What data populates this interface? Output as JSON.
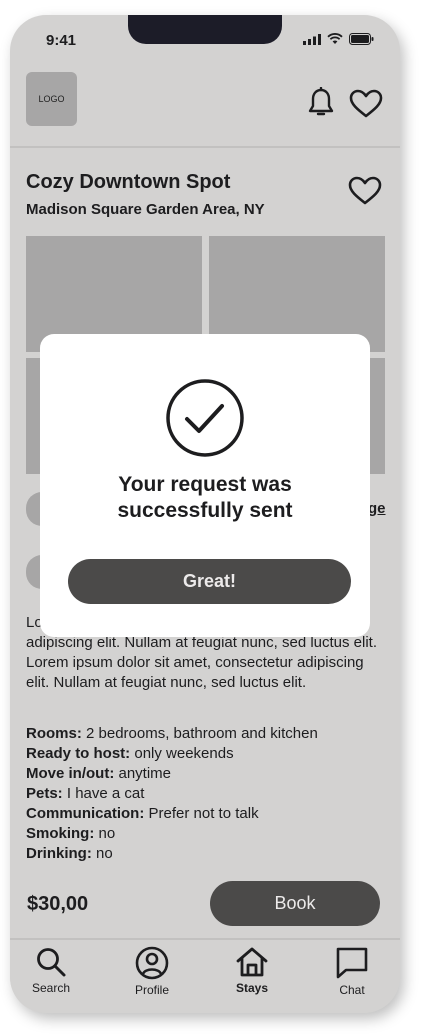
{
  "status": {
    "time": "9:41"
  },
  "header": {
    "logo_text": "LOGO"
  },
  "listing": {
    "title": "Cozy Downtown Spot",
    "location": "Madison Square Garden Area, NY",
    "description_partial_start": "Lo",
    "description_rest": "adipiscing elit. Nullam at feugiat nunc, sed luctus elit. Lorem ipsum dolor sit amet, consectetur adipiscing elit. Nullam at feugiat nunc, sed luctus elit.",
    "obscured_link_fragment": "ge",
    "attributes": [
      {
        "label": "Rooms:",
        "value": " 2 bedrooms, bathroom and kitchen"
      },
      {
        "label": "Ready to host:",
        "value": " only weekends"
      },
      {
        "label": "Move in/out:",
        "value": " anytime"
      },
      {
        "label": "Pets:",
        "value": " I have a cat"
      },
      {
        "label": "Communication:",
        "value": " Prefer not to talk"
      },
      {
        "label": "Smoking:",
        "value": " no"
      },
      {
        "label": "Drinking:",
        "value": " no"
      }
    ],
    "price": "$30,00",
    "book_label": "Book"
  },
  "modal": {
    "message_line1": "Your request was",
    "message_line2": "successfully sent",
    "button_label": "Great!"
  },
  "tabbar": {
    "items": [
      {
        "label": "Search",
        "icon": "search-icon"
      },
      {
        "label": "Profile",
        "icon": "profile-icon"
      },
      {
        "label": "Stays",
        "icon": "home-icon"
      },
      {
        "label": "Chat",
        "icon": "chat-icon"
      }
    ]
  },
  "colors": {
    "background": "#d3d2d1",
    "placeholder": "#a7a6a6",
    "button": "#4b4a49",
    "modal": "#ffffff"
  }
}
